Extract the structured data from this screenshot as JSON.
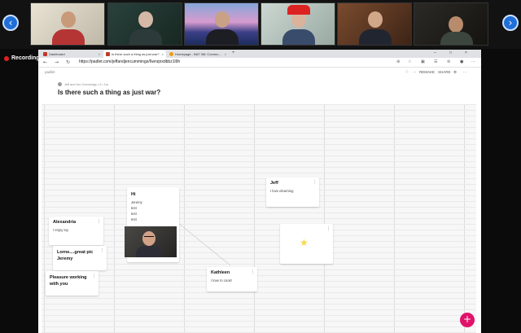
{
  "zoom": {
    "prev_icon": "chevron-left-icon",
    "next_icon": "chevron-right-icon",
    "recording_label": "Recording"
  },
  "browser": {
    "tabs": [
      {
        "label": "Dashboard",
        "close": "×",
        "favicon_color": "#c0392b"
      },
      {
        "label": "Is there such a thing as just war?",
        "close": "×",
        "favicon_color": "#c0392b"
      },
      {
        "label": "Homepage - BAT 3M: Commu...",
        "close": "×",
        "favicon_color": "#f39c12"
      }
    ],
    "new_tab": "+",
    "window_controls": [
      "–",
      "□",
      "×"
    ],
    "url": "https://padlet.com/jeffandjencummings/6wnqnxdbbz1l9h"
  },
  "padlet": {
    "brand": "padlet",
    "toolbar": [
      "♡",
      "⋯",
      "REMAKE",
      "SHARE",
      "⚙",
      "⋯"
    ],
    "byline": "Jeff and Jen Cummings  •  0  •  1m",
    "title": "Is there such a thing as just war?",
    "posts": {
      "hi": {
        "title": "Hi",
        "body": [
          "Jeremy",
          "test",
          "test",
          "test"
        ]
      },
      "jeff": {
        "title": "Jeff",
        "body": "I love elearning"
      },
      "alexandria": {
        "title": "Alexandria",
        "body": "I enjoy toy"
      },
      "lorne": {
        "title": "Lorne....great pic Jeremy",
        "body": ""
      },
      "pleasure": {
        "title": "Pleasure working with you",
        "body": ""
      },
      "kathleen": {
        "title": "Kathleen",
        "body": "I love to cook!"
      },
      "star": {
        "icon": "star-icon"
      }
    },
    "kebab": "⋮",
    "fab": "+"
  }
}
